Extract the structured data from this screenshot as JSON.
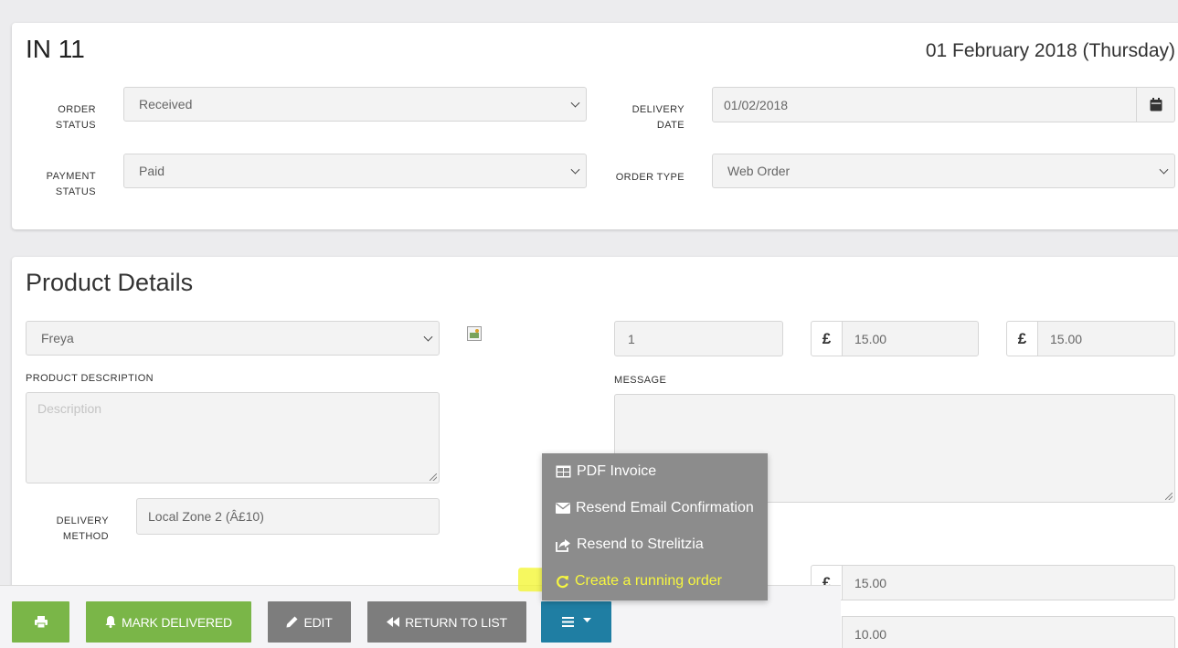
{
  "order": {
    "title": "IN 11",
    "date": "01 February 2018 (Thursday)",
    "order_status_label_1": "ORDER",
    "order_status_label_2": "STATUS",
    "order_status_value": "Received",
    "payment_status_label_1": "PAYMENT",
    "payment_status_label_2": "STATUS",
    "payment_status_value": "Paid",
    "delivery_date_label_1": "DELIVERY",
    "delivery_date_label_2": "DATE",
    "delivery_date_value": "01/02/2018",
    "order_type_label": "ORDER TYPE",
    "order_type_value": "Web Order"
  },
  "product": {
    "section_title": "Product Details",
    "product_select": "Freya",
    "quantity": "1",
    "currency_symbol": "£",
    "unit_price": "15.00",
    "total_price": "15.00",
    "description_label": "PRODUCT DESCRIPTION",
    "description_placeholder": "Description",
    "message_label": "MESSAGE",
    "delivery_method_label_1": "DELIVERY",
    "delivery_method_label_2": "METHOD",
    "delivery_method_value": "Local Zone 2 (Â£10)",
    "lower_price_1": "15.00",
    "lower_price_2": "10.00"
  },
  "toolbar": {
    "mark_delivered": "MARK DELIVERED",
    "edit": "EDIT",
    "return_to_list": "RETURN TO LIST"
  },
  "menu": {
    "items": [
      {
        "label": "PDF Invoice",
        "icon": "table-icon"
      },
      {
        "label": "Resend Email Confirmation",
        "icon": "envelope-icon"
      },
      {
        "label": "Resend to Strelitzia",
        "icon": "share-icon"
      },
      {
        "label": "Create a running order",
        "icon": "refresh-icon"
      }
    ]
  },
  "colors": {
    "green": "#7ab648",
    "grey": "#7d7d7d",
    "blue": "#1f7ea3",
    "menu_bg": "#8c8c8c",
    "highlight": "#f3f52a"
  }
}
